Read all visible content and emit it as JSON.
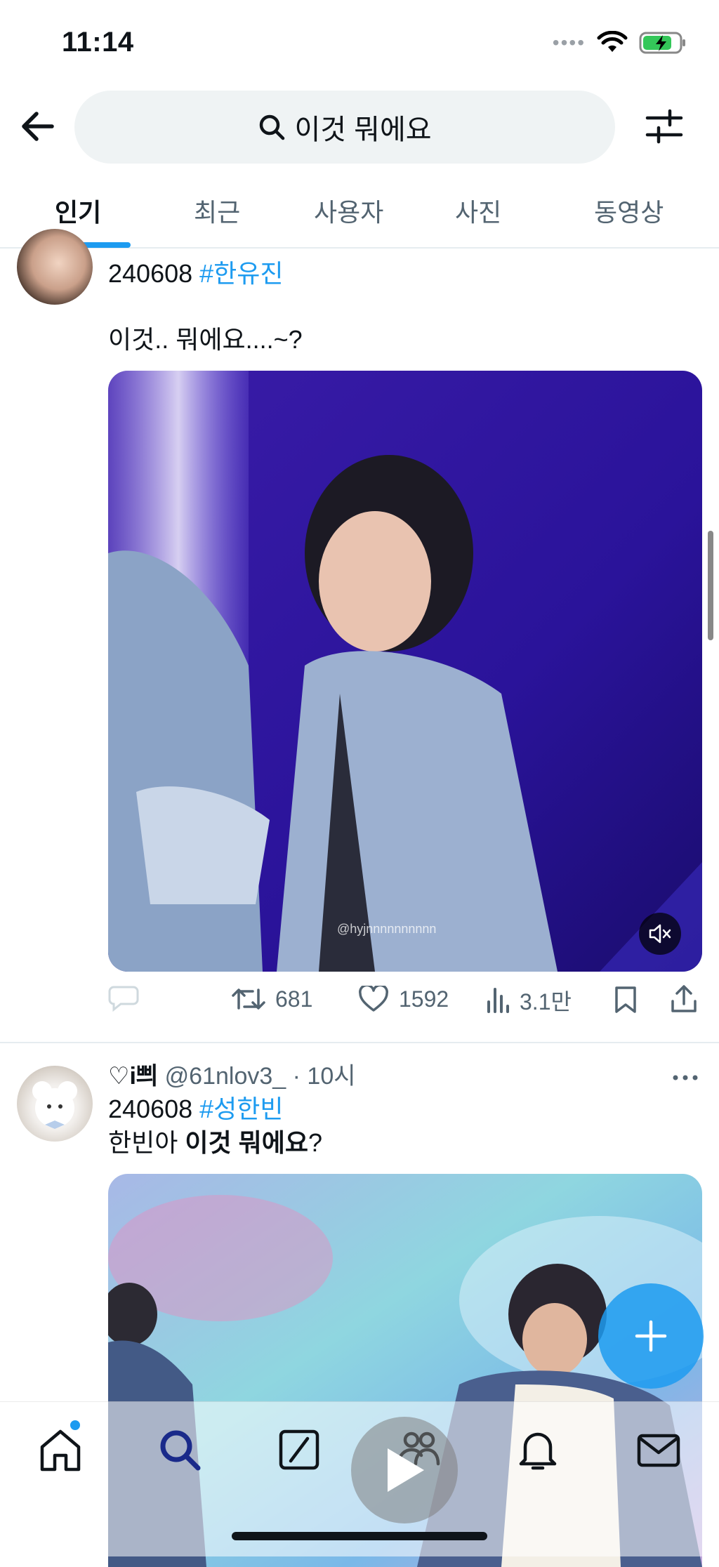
{
  "status_bar": {
    "time": "11:14"
  },
  "search": {
    "query": "이것 뭐에요"
  },
  "tabs": [
    {
      "label": "인기",
      "active": true
    },
    {
      "label": "최근",
      "active": false
    },
    {
      "label": "사용자",
      "active": false
    },
    {
      "label": "사진",
      "active": false
    },
    {
      "label": "동영상",
      "active": false
    }
  ],
  "posts": [
    {
      "date_text": "240608",
      "hashtag": "#한유진",
      "body": "이것.. 뭐에요....~?",
      "watermark": "@hyjnnnnnnnnnn",
      "actions": {
        "retweets": "681",
        "likes": "1592",
        "views": "3.1만"
      }
    },
    {
      "display_name": "♡i쁴",
      "handle_time": "@61nlov3_ · 10시",
      "date_text": "240608",
      "hashtag": "#성한빈",
      "body_prefix": "한빈아 ",
      "body_bold": "이것 뭐에요",
      "body_suffix": "?"
    }
  ],
  "colors": {
    "accent": "#1d9bf0",
    "text": "#0f1419",
    "muted": "#536471",
    "divider": "#e6ecf0"
  },
  "icons": [
    "back-arrow-icon",
    "search-icon",
    "filter-icon",
    "reply-icon",
    "retweet-icon",
    "like-icon",
    "views-icon",
    "bookmark-icon",
    "share-icon",
    "mute-icon",
    "more-icon",
    "plus-icon",
    "home-icon",
    "explore-icon",
    "grok-icon",
    "communities-icon",
    "notifications-icon",
    "messages-icon",
    "play-icon"
  ]
}
